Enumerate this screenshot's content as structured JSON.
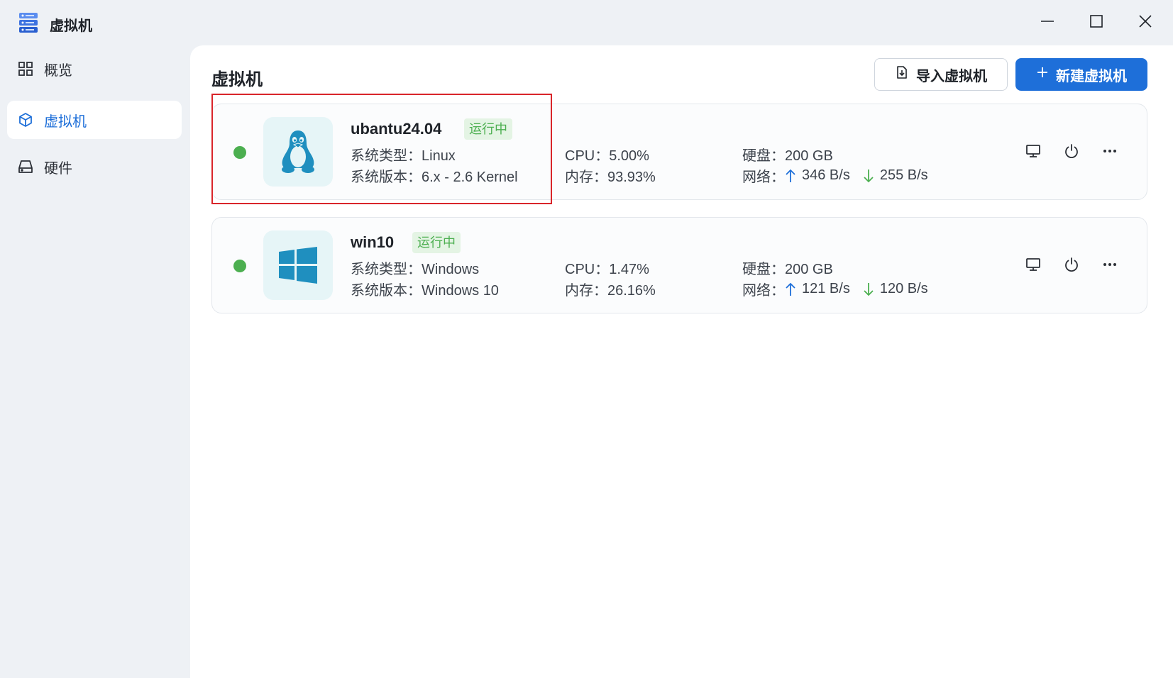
{
  "window": {
    "title": "虚拟机",
    "icons": {
      "app": "server-stack-icon",
      "minimize": "minimize-icon",
      "maximize": "maximize-icon",
      "close": "close-icon"
    }
  },
  "sidebar": {
    "items": [
      {
        "label": "概览",
        "icon": "grid-icon",
        "active": false
      },
      {
        "label": "虚拟机",
        "icon": "cube-icon",
        "active": true
      },
      {
        "label": "硬件",
        "icon": "hard-drive-icon",
        "active": false
      }
    ]
  },
  "main": {
    "title": "虚拟机",
    "import_button": "导入虚拟机",
    "new_button": "新建虚拟机"
  },
  "vms": [
    {
      "name": "ubantu24.04",
      "status": "运行中",
      "status_color": "#4caf50",
      "os_icon": "linux-penguin-icon",
      "type_text": "系统类型：Linux",
      "version_text": "系统版本：6.x - 2.6 Kernel",
      "cpu_text": "CPU：5.00%",
      "memory_text": "内存：93.93%",
      "disk_text": "硬盘：200 GB",
      "network_label": "网络：",
      "upload": "346 B/s",
      "download": "255 B/s",
      "highlighted": true
    },
    {
      "name": "win10",
      "status": "运行中",
      "status_color": "#4caf50",
      "os_icon": "windows-logo-icon",
      "type_text": "系统类型：Windows",
      "version_text": "系统版本：Windows 10",
      "cpu_text": "CPU：1.47%",
      "memory_text": "内存：26.16%",
      "disk_text": "硬盘：200 GB",
      "network_label": "网络：",
      "upload": "121 B/s",
      "download": "120 B/s",
      "highlighted": false
    }
  ],
  "colors": {
    "accent": "#1e6fd9",
    "running": "#4caf50",
    "upload_arrow": "#1e6fd9",
    "download_arrow": "#4caf50",
    "highlight": "#d9252a"
  }
}
